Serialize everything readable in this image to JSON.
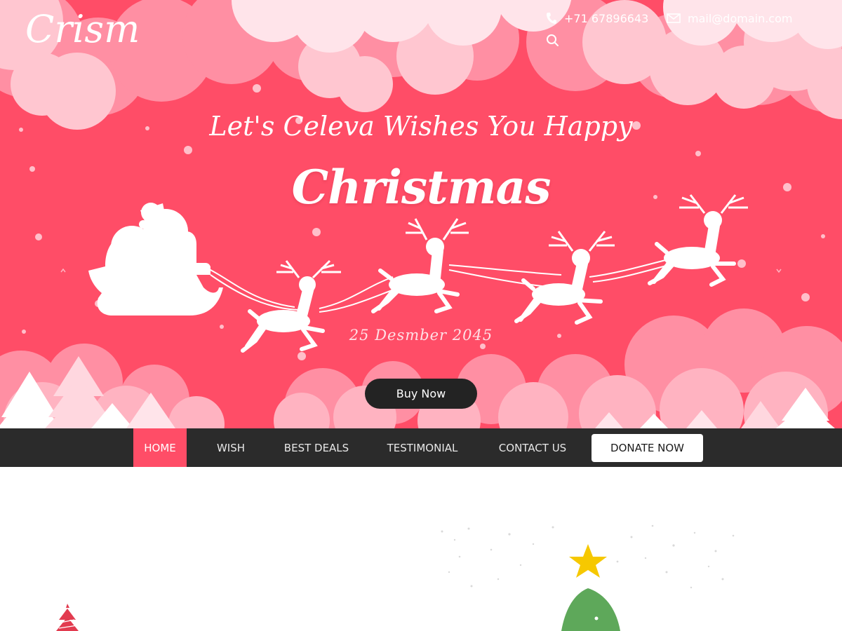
{
  "brand": {
    "logo_text": "Crism"
  },
  "contact": {
    "phone": "+71 67896643",
    "email": "mail@domain.com",
    "phone_icon": "phone-icon",
    "mail_icon": "mail-icon",
    "search_icon": "search-icon"
  },
  "hero": {
    "tagline": "Let's Celeva Wishes You Happy",
    "headline": "Christmas",
    "date": "25 Desmber 2045",
    "cta_label": "Buy Now",
    "prev_icon": "chevron-left-icon",
    "next_icon": "chevron-right-icon"
  },
  "nav": {
    "items": [
      {
        "label": "HOME",
        "active": true
      },
      {
        "label": "WISH",
        "active": false
      },
      {
        "label": "BEST DEALS",
        "active": false
      },
      {
        "label": "TESTIMONIAL",
        "active": false
      },
      {
        "label": "CONTACT US",
        "active": false
      }
    ],
    "donate_label": "DONATE NOW"
  },
  "colors": {
    "hero_background": "#ff4d67",
    "cloud_light": "#ffc6d0",
    "cloud_mid": "#ff8fa3",
    "nav_background": "#2b2b2b",
    "active_nav": "#ff4d67",
    "cta_background": "#232323"
  },
  "illustrations": {
    "sleigh": "santa-sleigh-reindeer-silhouette",
    "lower_right": "christmas-tree-with-star",
    "lower_left": "small-christmas-tree-logo"
  }
}
